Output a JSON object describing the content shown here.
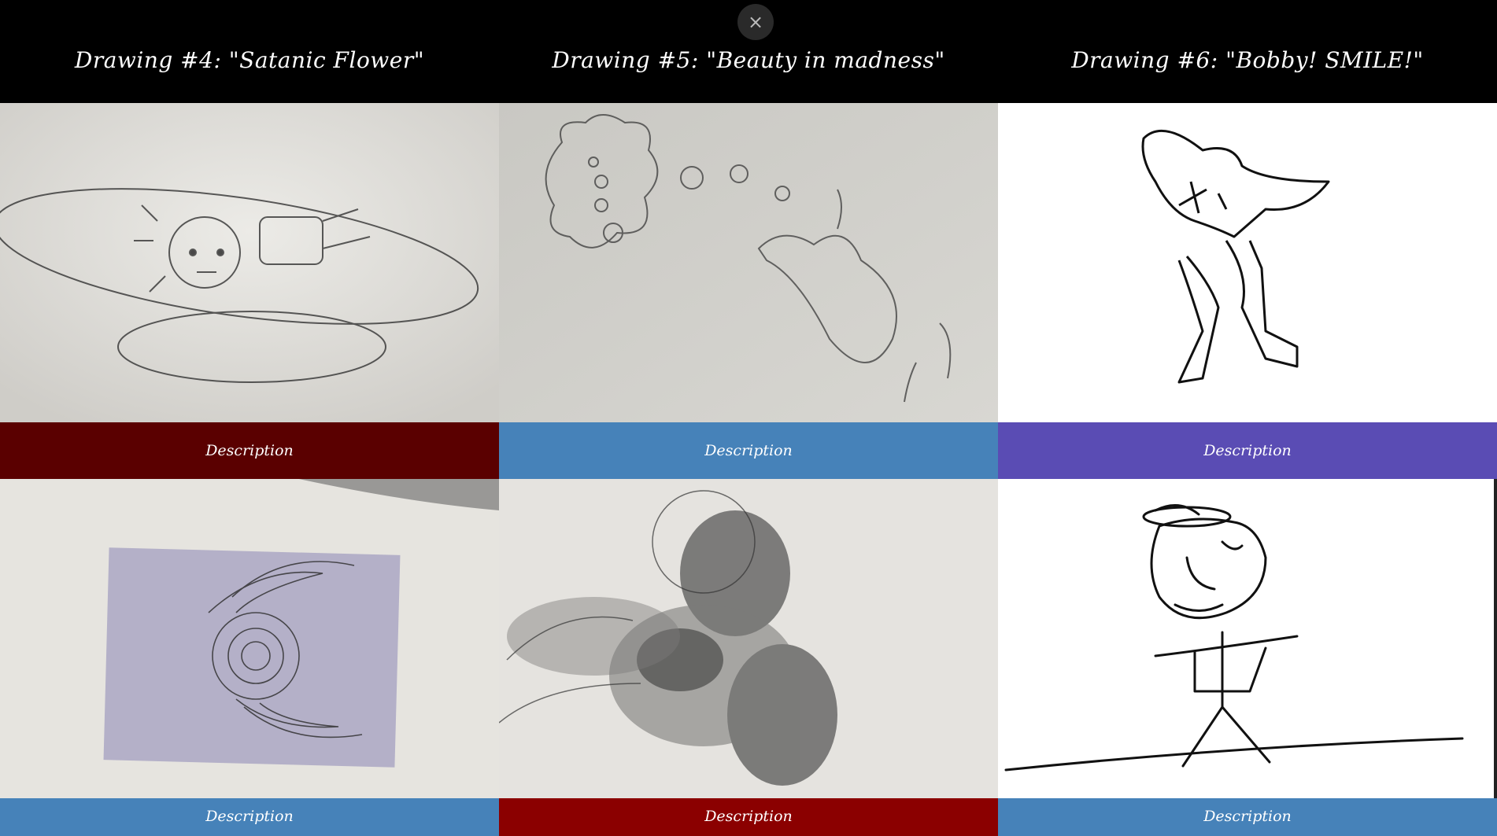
{
  "close_icon": "×",
  "drawings": [
    {
      "title": "Drawing #4: \"Satanic Flower\"",
      "description": "Description",
      "color": "#5a0000"
    },
    {
      "title": "Drawing #5: \"Beauty in madness\"",
      "description": "Description",
      "color": "#4682b9"
    },
    {
      "title": "Drawing #6: \"Bobby! SMILE!\"",
      "description": "Description",
      "color": "#5a4cb4"
    },
    {
      "description": "Description",
      "color": "#4682b9"
    },
    {
      "description": "Description",
      "color": "#8b0000"
    },
    {
      "description": "Description",
      "color": "#4682b9"
    }
  ]
}
